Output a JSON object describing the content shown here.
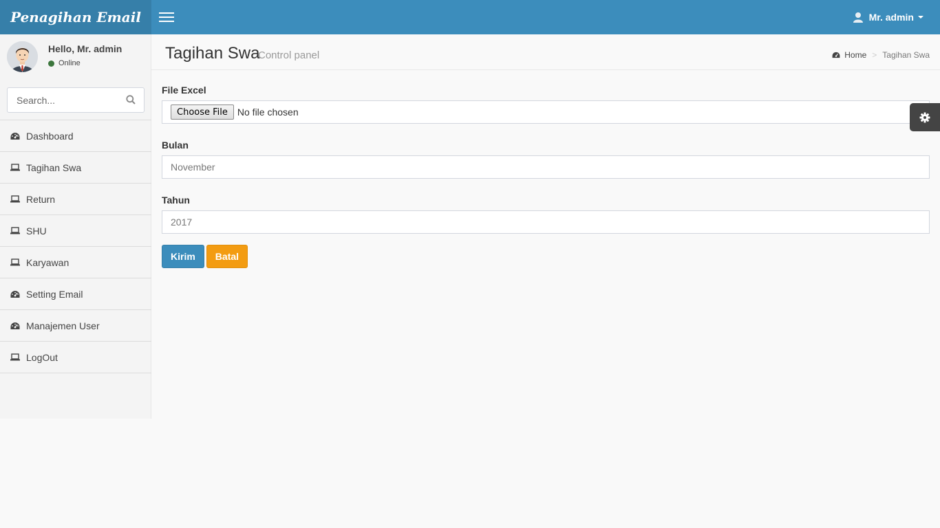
{
  "app": {
    "title": "Penagihan Email"
  },
  "header": {
    "user_label": "Mr. admin"
  },
  "sidebar": {
    "greeting": "Hello, Mr. admin",
    "status": "Online",
    "search_placeholder": "Search...",
    "items": [
      {
        "label": "Dashboard",
        "icon": "dashboard-icon"
      },
      {
        "label": "Tagihan Swa",
        "icon": "laptop-icon"
      },
      {
        "label": "Return",
        "icon": "laptop-icon"
      },
      {
        "label": "SHU",
        "icon": "laptop-icon"
      },
      {
        "label": "Karyawan",
        "icon": "laptop-icon"
      },
      {
        "label": "Setting Email",
        "icon": "dashboard-icon"
      },
      {
        "label": "Manajemen User",
        "icon": "dashboard-icon"
      },
      {
        "label": "LogOut",
        "icon": "laptop-icon"
      }
    ]
  },
  "page": {
    "title": "Tagihan Swa",
    "subtitle": "Control panel",
    "breadcrumb": {
      "home": "Home",
      "separator": ">",
      "current": "Tagihan Swa"
    }
  },
  "form": {
    "file_label": "File Excel",
    "file_button": "Choose File",
    "file_status": "No file chosen",
    "bulan_label": "Bulan",
    "bulan_value": "November",
    "tahun_label": "Tahun",
    "tahun_value": "2017",
    "submit_label": "Kirim",
    "cancel_label": "Batal"
  },
  "colors": {
    "header": "#3c8dbc",
    "logo_bg": "#367fa9",
    "primary": "#3c8dbc",
    "warning": "#f39c12",
    "online": "#3c763d"
  }
}
